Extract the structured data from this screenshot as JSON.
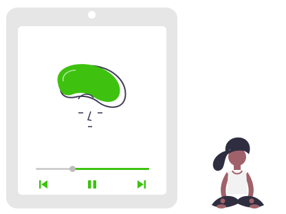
{
  "player": {
    "progress": 0.32,
    "controls": {
      "previous_icon": "skip-previous-icon",
      "pause_icon": "pause-icon",
      "next_icon": "skip-next-icon"
    }
  },
  "illustration": {
    "main": "meditating-head-illustration",
    "person": "meditating-woman-illustration"
  },
  "colors": {
    "accent": "#3ec20f",
    "device": "#e6e6e6",
    "track": "#cfcfcf",
    "knob": "#bdbdbd",
    "ink": "#3f3d56",
    "skin": "#a0616a"
  }
}
